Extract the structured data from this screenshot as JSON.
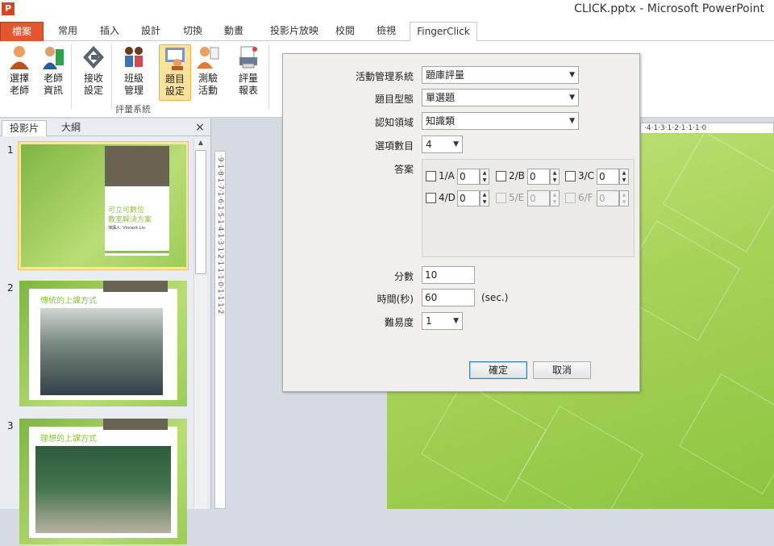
{
  "window": {
    "title": "CLICK.pptx - Microsoft PowerPoint",
    "app_icon": "P"
  },
  "tabs": [
    "檔案",
    "常用",
    "插入",
    "設計",
    "切換",
    "動畫",
    "投影片放映",
    "校閱",
    "檢視",
    "FingerClick"
  ],
  "ribbon": {
    "buttons": [
      {
        "label1": "選擇",
        "label2": "老師",
        "icon": "person-icon"
      },
      {
        "label1": "老師",
        "label2": "資訊",
        "icon": "teacher-info-icon"
      },
      {
        "label1": "接收",
        "label2": "設定",
        "icon": "receiver-settings-icon"
      },
      {
        "label1": "班級",
        "label2": "管理",
        "icon": "class-management-icon"
      },
      {
        "label1": "題目",
        "label2": "設定",
        "icon": "question-settings-icon"
      },
      {
        "label1": "測驗",
        "label2": "活動",
        "icon": "quiz-activity-icon"
      },
      {
        "label1": "評量",
        "label2": "報表",
        "icon": "report-icon"
      }
    ],
    "group_label": "評量系統"
  },
  "panel": {
    "tab_slides": "投影片",
    "tab_outline": "大綱",
    "close": "×"
  },
  "slides": [
    {
      "num": "1",
      "title": "可立可數位",
      "subtitle": "教室解決方案",
      "author": "演講人: Vincent Lin"
    },
    {
      "num": "2",
      "title": "傳統的上課方式"
    },
    {
      "num": "3",
      "title": "理想的上課方式"
    }
  ],
  "ruler": {
    "h": "·4·1·3·1·2·1·1·1·0",
    "v": "·9·1·8·1·7·1·6·1·5·1·4·1·3·1·2·1·1·1·0·1·1·1·2"
  },
  "dialog": {
    "activity_label": "活動管理系統",
    "activity_value": "題庫評量",
    "type_label": "題目型態",
    "type_value": "單選題",
    "domain_label": "認知領域",
    "domain_value": "知識類",
    "count_label": "選項數目",
    "count_value": "4",
    "answer_label": "答案",
    "options": [
      {
        "label": "1/A",
        "value": "0"
      },
      {
        "label": "2/B",
        "value": "0"
      },
      {
        "label": "3/C",
        "value": "0"
      },
      {
        "label": "4/D",
        "value": "0"
      },
      {
        "label": "5/E",
        "value": "0"
      },
      {
        "label": "6/F",
        "value": "0"
      }
    ],
    "score_label": "分數",
    "score_value": "10",
    "time_label": "時間(秒)",
    "time_value": "60",
    "time_unit": "(sec.)",
    "difficulty_label": "難易度",
    "difficulty_value": "1",
    "ok": "確定",
    "cancel": "取消"
  }
}
